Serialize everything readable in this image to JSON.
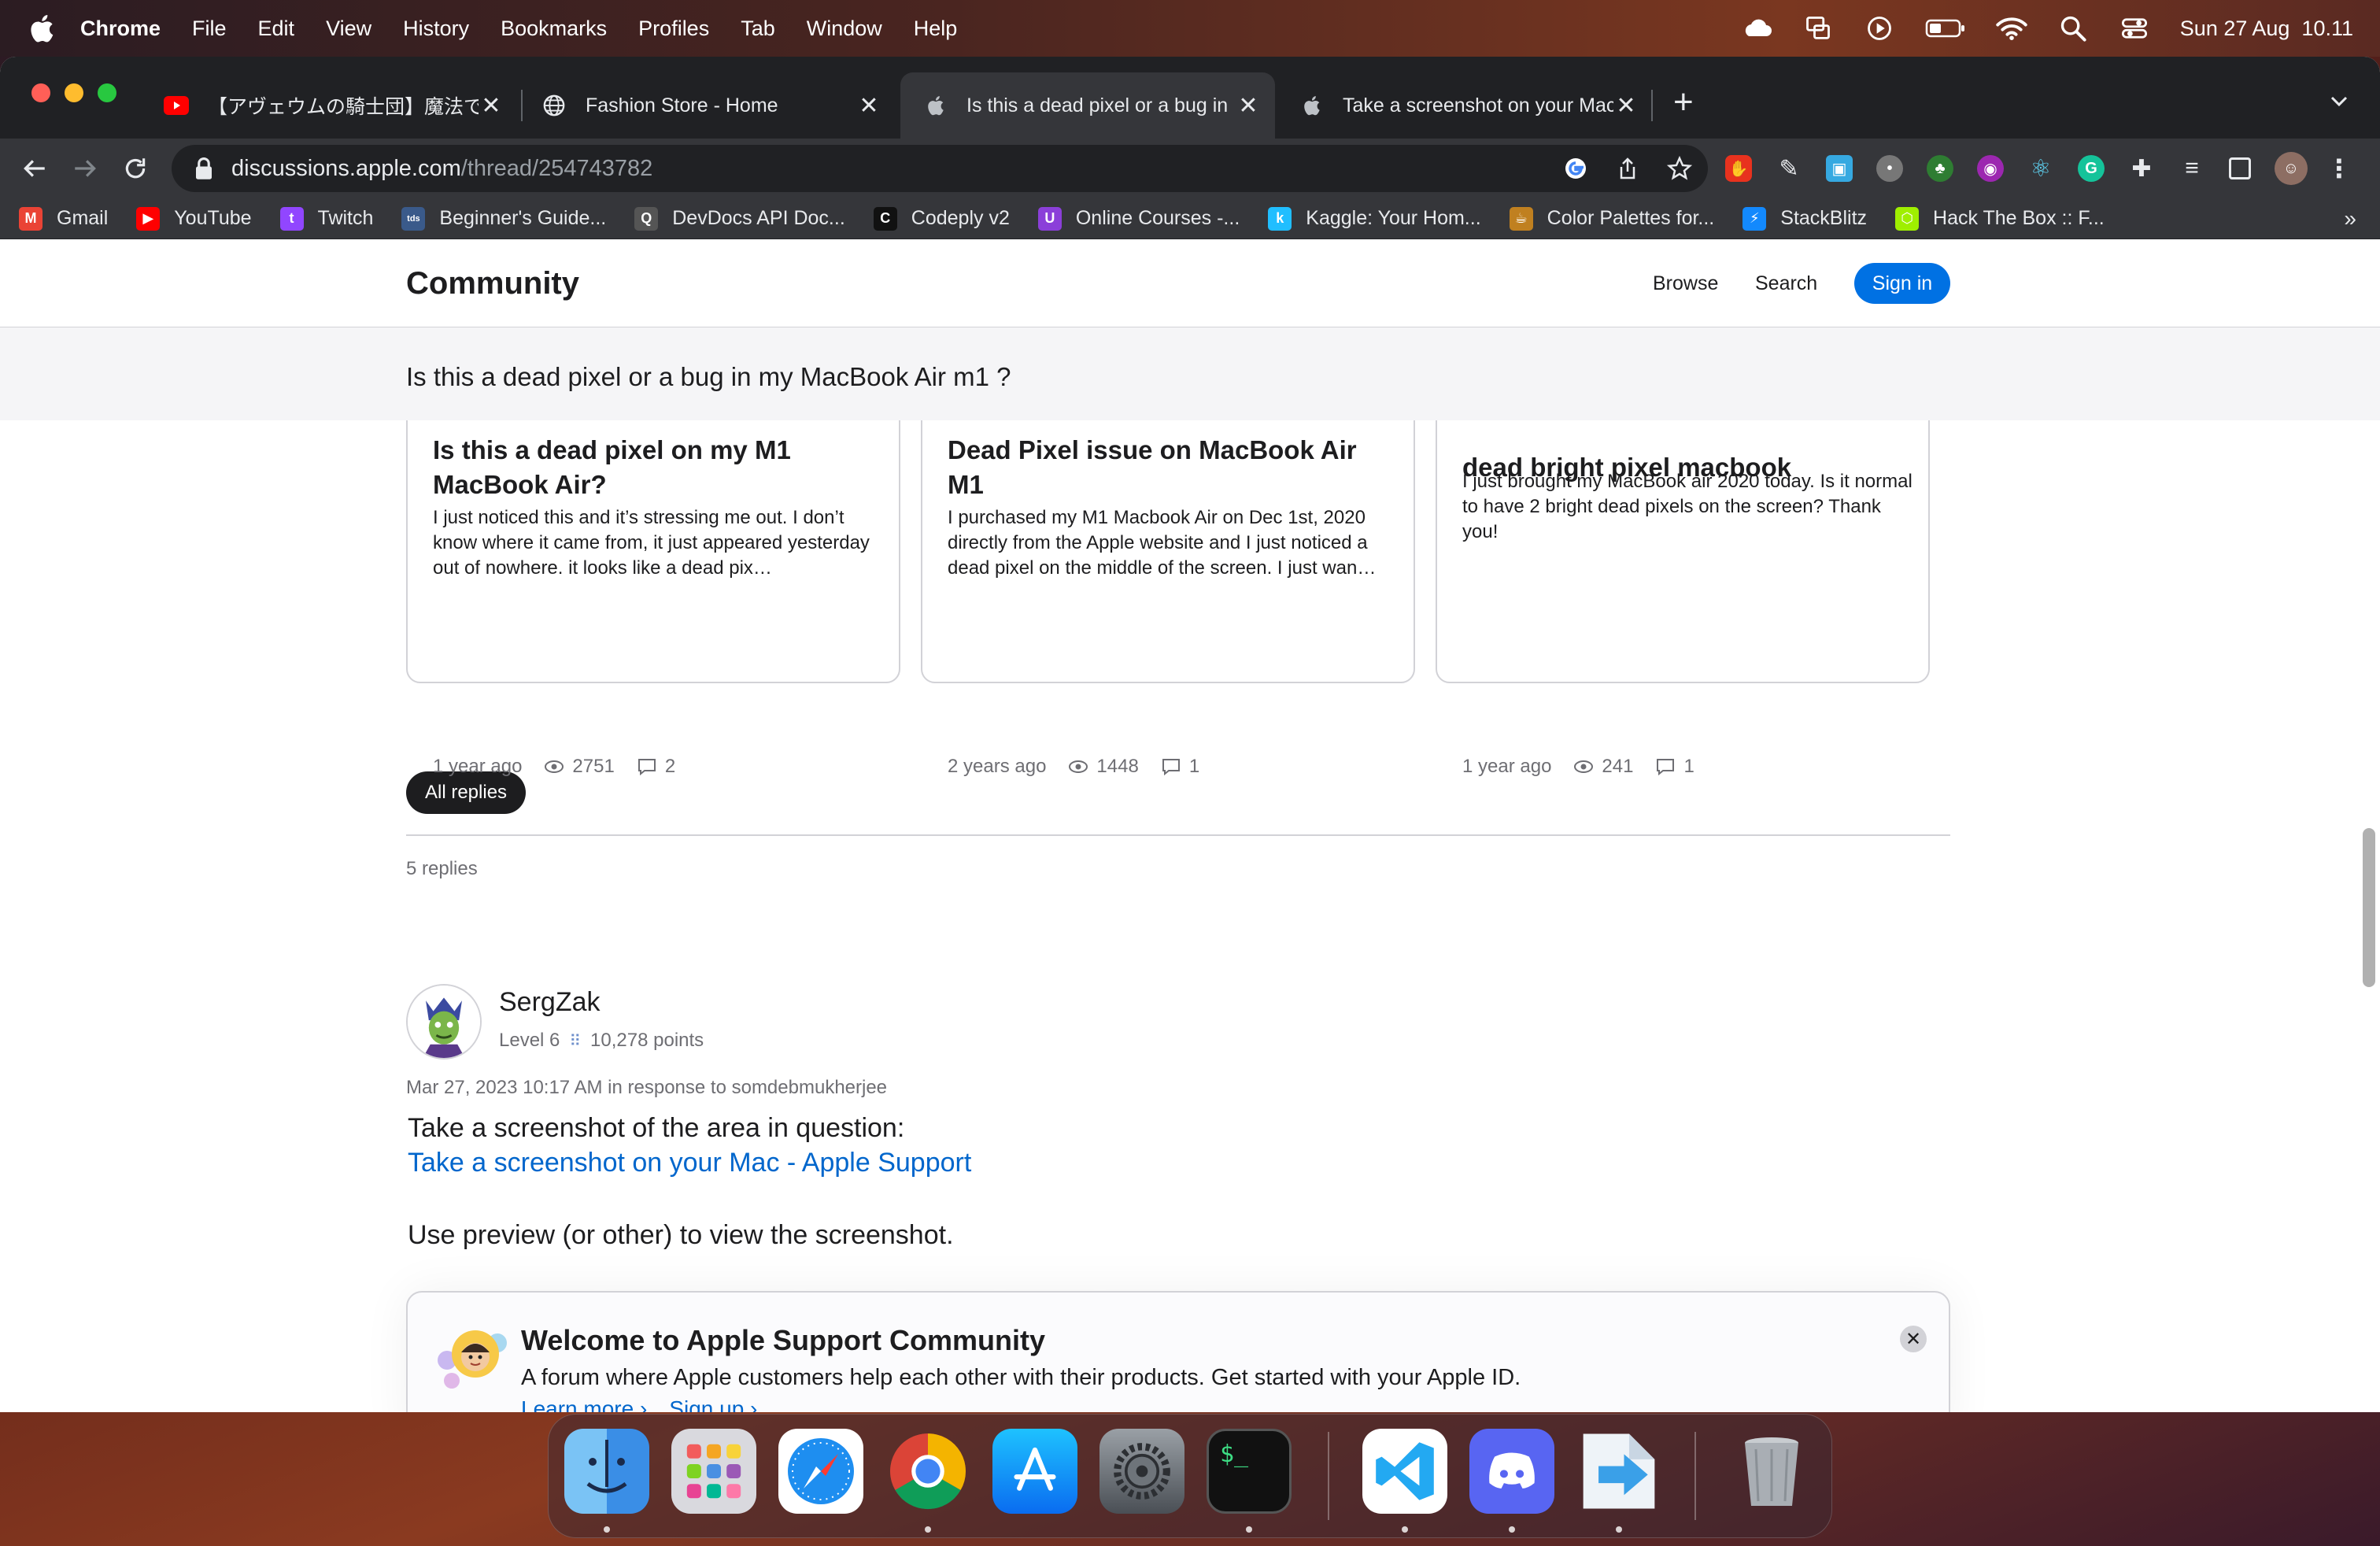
{
  "menubar": {
    "app": "Chrome",
    "items": [
      "File",
      "Edit",
      "View",
      "History",
      "Bookmarks",
      "Profiles",
      "Tab",
      "Window",
      "Help"
    ],
    "datetime": "Sun 27 Aug  10.11"
  },
  "tabs": [
    {
      "title": "【アヴェウムの騎士団】魔法で",
      "icon": "youtube-icon"
    },
    {
      "title": "Fashion Store - Home",
      "icon": "globe-icon"
    },
    {
      "title": "Is this a dead pixel or a bug in",
      "icon": "apple-icon"
    },
    {
      "title": "Take a screenshot on your Mac",
      "icon": "apple-icon"
    }
  ],
  "address": {
    "host": "discussions.apple.com",
    "path": "/thread/254743782"
  },
  "bookmarks": [
    {
      "label": "Gmail",
      "color": "#ea4335",
      "glyph": "M"
    },
    {
      "label": "YouTube",
      "color": "#ff0000",
      "glyph": "▶"
    },
    {
      "label": "Twitch",
      "color": "#9146ff",
      "glyph": "t"
    },
    {
      "label": "Beginner's Guide...",
      "color": "#3a5a8a",
      "glyph": "tds"
    },
    {
      "label": "DevDocs API Doc...",
      "color": "#555555",
      "glyph": "Q"
    },
    {
      "label": "Codeply v2",
      "color": "#111111",
      "glyph": "C"
    },
    {
      "label": "Online Courses -...",
      "color": "#8b3fd9",
      "glyph": "U"
    },
    {
      "label": "Kaggle: Your Hom...",
      "color": "#20beff",
      "glyph": "k"
    },
    {
      "label": "Color Palettes for...",
      "color": "#c08020",
      "glyph": "☕"
    },
    {
      "label": "StackBlitz",
      "color": "#1389fd",
      "glyph": "⚡"
    },
    {
      "label": "Hack The Box :: F...",
      "color": "#9fef00",
      "glyph": "⬡"
    }
  ],
  "community": {
    "brand": "Community",
    "browse": "Browse",
    "search": "Search",
    "signin": "Sign in"
  },
  "thread_title": "Is this a dead pixel or a bug in my MacBook Air m1 ?",
  "cards": [
    {
      "title": "Is this a dead pixel on my M1 MacBook Air?",
      "body": "I just noticed this and it’s stressing me out. I don’t know where it came from, it just appeared yesterday out of nowhere. it looks like a dead pix…",
      "age": "1 year ago",
      "views": "2751",
      "replies": "2"
    },
    {
      "title": "Dead Pixel issue on MacBook Air M1",
      "body": "I purchased my M1 Macbook Air on Dec 1st, 2020 directly from the Apple website and I just noticed a dead pixel on the middle of the screen. I just wan…",
      "age": "2 years ago",
      "views": "1448",
      "replies": "1"
    },
    {
      "title": "dead bright pixel macbook",
      "body": "I just brought my MacBook air 2020 today. Is it normal to have 2 bright dead pixels on the screen? Thank you!",
      "age": "1 year ago",
      "views": "241",
      "replies": "1"
    }
  ],
  "replies": {
    "filter": "All replies",
    "count": "5 replies"
  },
  "post": {
    "author": "SergZak",
    "level": "Level 6",
    "points": "10,278 points",
    "date": "Mar 27, 2023 10:17 AM in response to somdebmukherjee",
    "line1": "Take a screenshot of the area in question:",
    "link": "Take a screenshot on your Mac - Apple Support",
    "line2": "Use preview (or other) to view the screenshot."
  },
  "welcome": {
    "title": "Welcome to Apple Support Community",
    "body": "A forum where Apple customers help each other with their products. Get started with your Apple ID.",
    "learn_more": "Learn more ›",
    "sign_up": "Sign up ›"
  },
  "dock": [
    "finder-icon",
    "launchpad-icon",
    "safari-icon",
    "chrome-icon",
    "app-store-icon",
    "system-settings-icon",
    "terminal-icon",
    "vscode-icon",
    "discord-icon",
    "migration-icon",
    "trash-icon"
  ]
}
